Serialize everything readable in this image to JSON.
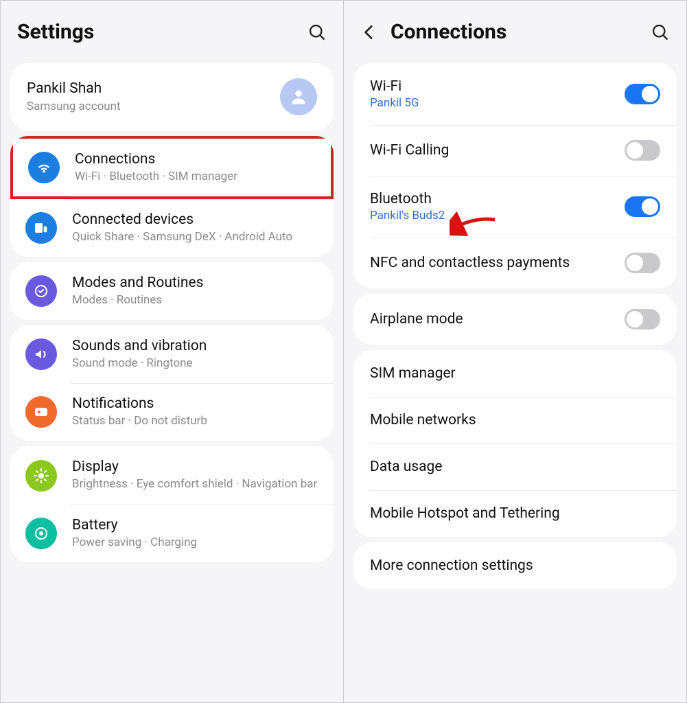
{
  "left": {
    "title": "Settings",
    "account": {
      "name": "Pankil Shah",
      "sub": "Samsung account"
    },
    "groups": [
      {
        "highlightIndex": 0,
        "items": [
          {
            "icon": "wifi",
            "color": "#1b7ee0",
            "title": "Connections",
            "sub": "Wi-Fi  ·  Bluetooth  ·  SIM manager"
          },
          {
            "icon": "devices",
            "color": "#1b7ee0",
            "title": "Connected devices",
            "sub": "Quick Share  ·  Samsung DeX  ·  Android Auto"
          }
        ]
      },
      {
        "items": [
          {
            "icon": "routines",
            "color": "#6a5ae0",
            "title": "Modes and Routines",
            "sub": "Modes  ·  Routines"
          }
        ]
      },
      {
        "items": [
          {
            "icon": "sound",
            "color": "#6a5ae0",
            "title": "Sounds and vibration",
            "sub": "Sound mode  ·  Ringtone"
          },
          {
            "icon": "notif",
            "color": "#f06a2c",
            "title": "Notifications",
            "sub": "Status bar  ·  Do not disturb"
          }
        ]
      },
      {
        "items": [
          {
            "icon": "display",
            "color": "#8bc81e",
            "title": "Display",
            "sub": "Brightness  ·  Eye comfort shield  ·  Navigation bar"
          },
          {
            "icon": "battery",
            "color": "#0bbfa0",
            "title": "Battery",
            "sub": "Power saving  ·  Charging"
          }
        ]
      }
    ]
  },
  "right": {
    "title": "Connections",
    "groups": [
      [
        {
          "title": "Wi-Fi",
          "sub": "Pankil 5G",
          "toggle": "on"
        },
        {
          "title": "Wi-Fi Calling",
          "toggle": "off"
        },
        {
          "title": "Bluetooth",
          "sub": "Pankil's Buds2",
          "toggle": "on"
        },
        {
          "title": "NFC and contactless payments",
          "toggle": "off"
        }
      ],
      [
        {
          "title": "Airplane mode",
          "toggle": "off"
        }
      ],
      [
        {
          "title": "SIM manager"
        },
        {
          "title": "Mobile networks"
        },
        {
          "title": "Data usage"
        },
        {
          "title": "Mobile Hotspot and Tethering"
        }
      ],
      [
        {
          "title": "More connection settings"
        }
      ]
    ]
  },
  "iconColors": {
    "wifi": "#1b7ee0",
    "devices": "#1b7ee0",
    "routines": "#6a5ae0",
    "sound": "#6a5ae0",
    "notif": "#f06a2c",
    "display": "#8bc81e",
    "battery": "#0bbfa0"
  }
}
